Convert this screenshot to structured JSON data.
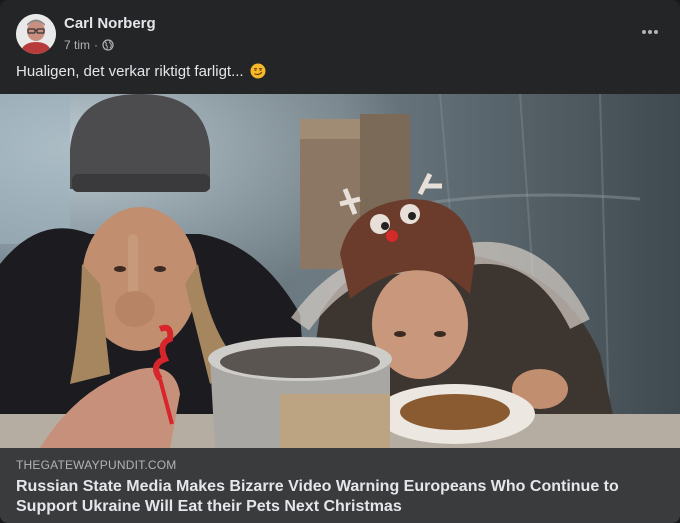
{
  "post": {
    "author": "Carl Norberg",
    "time": "7 tim",
    "separator": "·",
    "audience_icon": "globe-icon",
    "caption": "Hualigen, det verkar riktigt farligt...",
    "caption_emoji": "smirking-face-emoji"
  },
  "link_preview": {
    "domain": "THEGATEWAYPUNDIT.COM",
    "title": "Russian State Media Makes Bizarre Video Warning Europeans Who Continue to Support Ukraine Will Eat their Pets Next Christmas"
  },
  "colors": {
    "card_bg": "#242526",
    "link_bg": "#3a3b3c",
    "primary_text": "#e4e6eb",
    "secondary_text": "#b0b3b8"
  }
}
